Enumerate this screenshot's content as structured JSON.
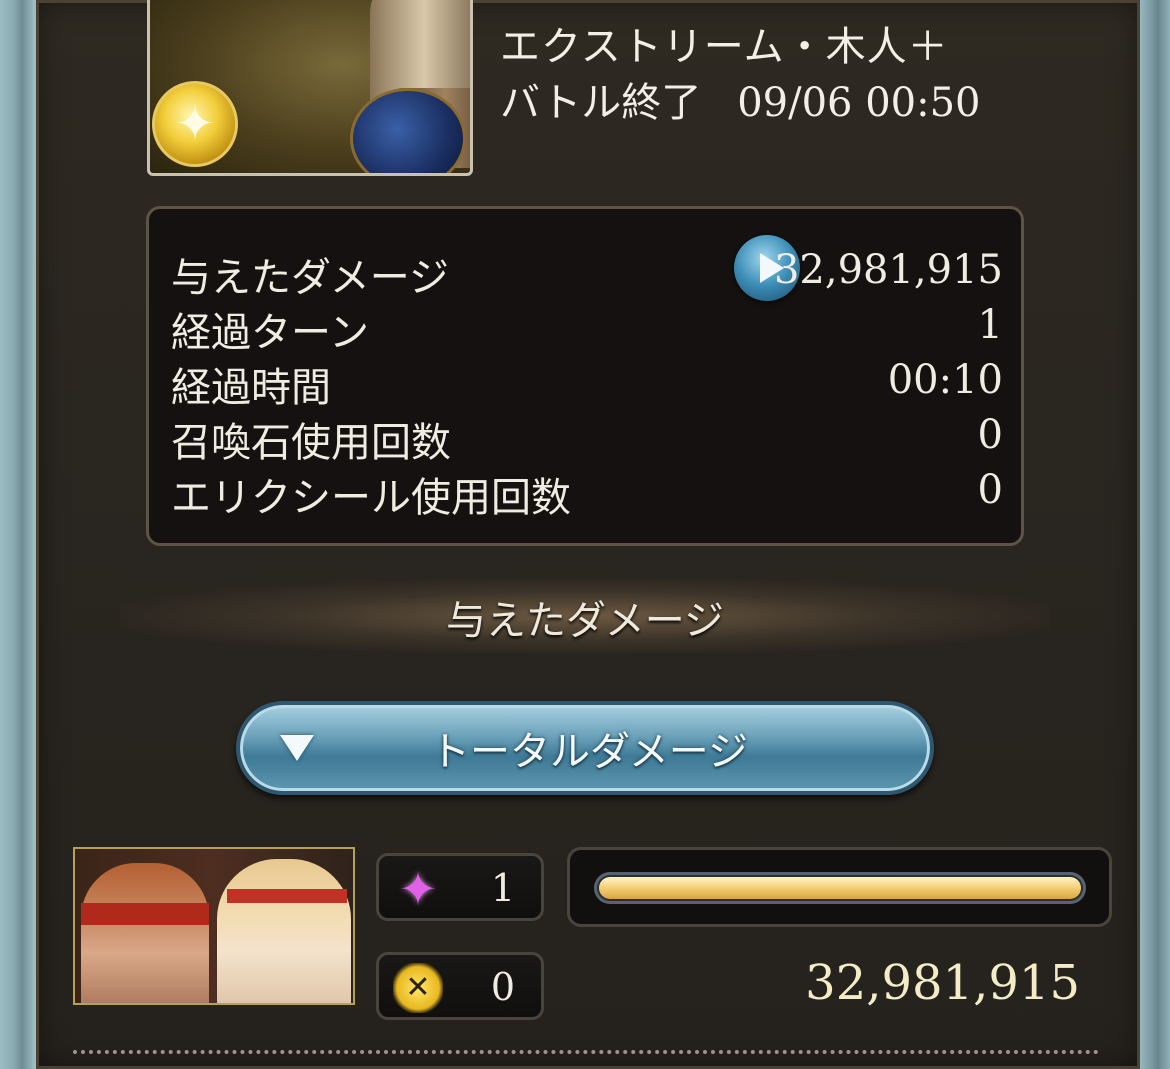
{
  "quest": {
    "title": "エクストリーム・木人＋",
    "status": "バトル終了",
    "datetime": "09/06 00:50",
    "element_icon": "light-element-icon"
  },
  "stats": {
    "rows": [
      {
        "label": "与えたダメージ",
        "value": "32,981,915"
      },
      {
        "label": "経過ターン",
        "value": "1"
      },
      {
        "label": "経過時間",
        "value": "00:10"
      },
      {
        "label": "召喚石使用回数",
        "value": "0"
      },
      {
        "label": "エリクシール使用回数",
        "value": "0"
      }
    ],
    "play_icon": "play-icon"
  },
  "section": {
    "title": "与えたダメージ"
  },
  "dropdown": {
    "label": "トータルダメージ",
    "icon": "chevron-down-icon"
  },
  "character": {
    "skill_count_icon": "sparkle-icon",
    "skill_count": "1",
    "ougi_count_icon": "ougi-icon",
    "ougi_count": "0",
    "damage": "32,981,915",
    "damage_share": 1.0
  },
  "colors": {
    "bar_fill": "#f6d27a",
    "dropdown_blue": "#3f7a96",
    "panel_bg": "#2a2620"
  }
}
